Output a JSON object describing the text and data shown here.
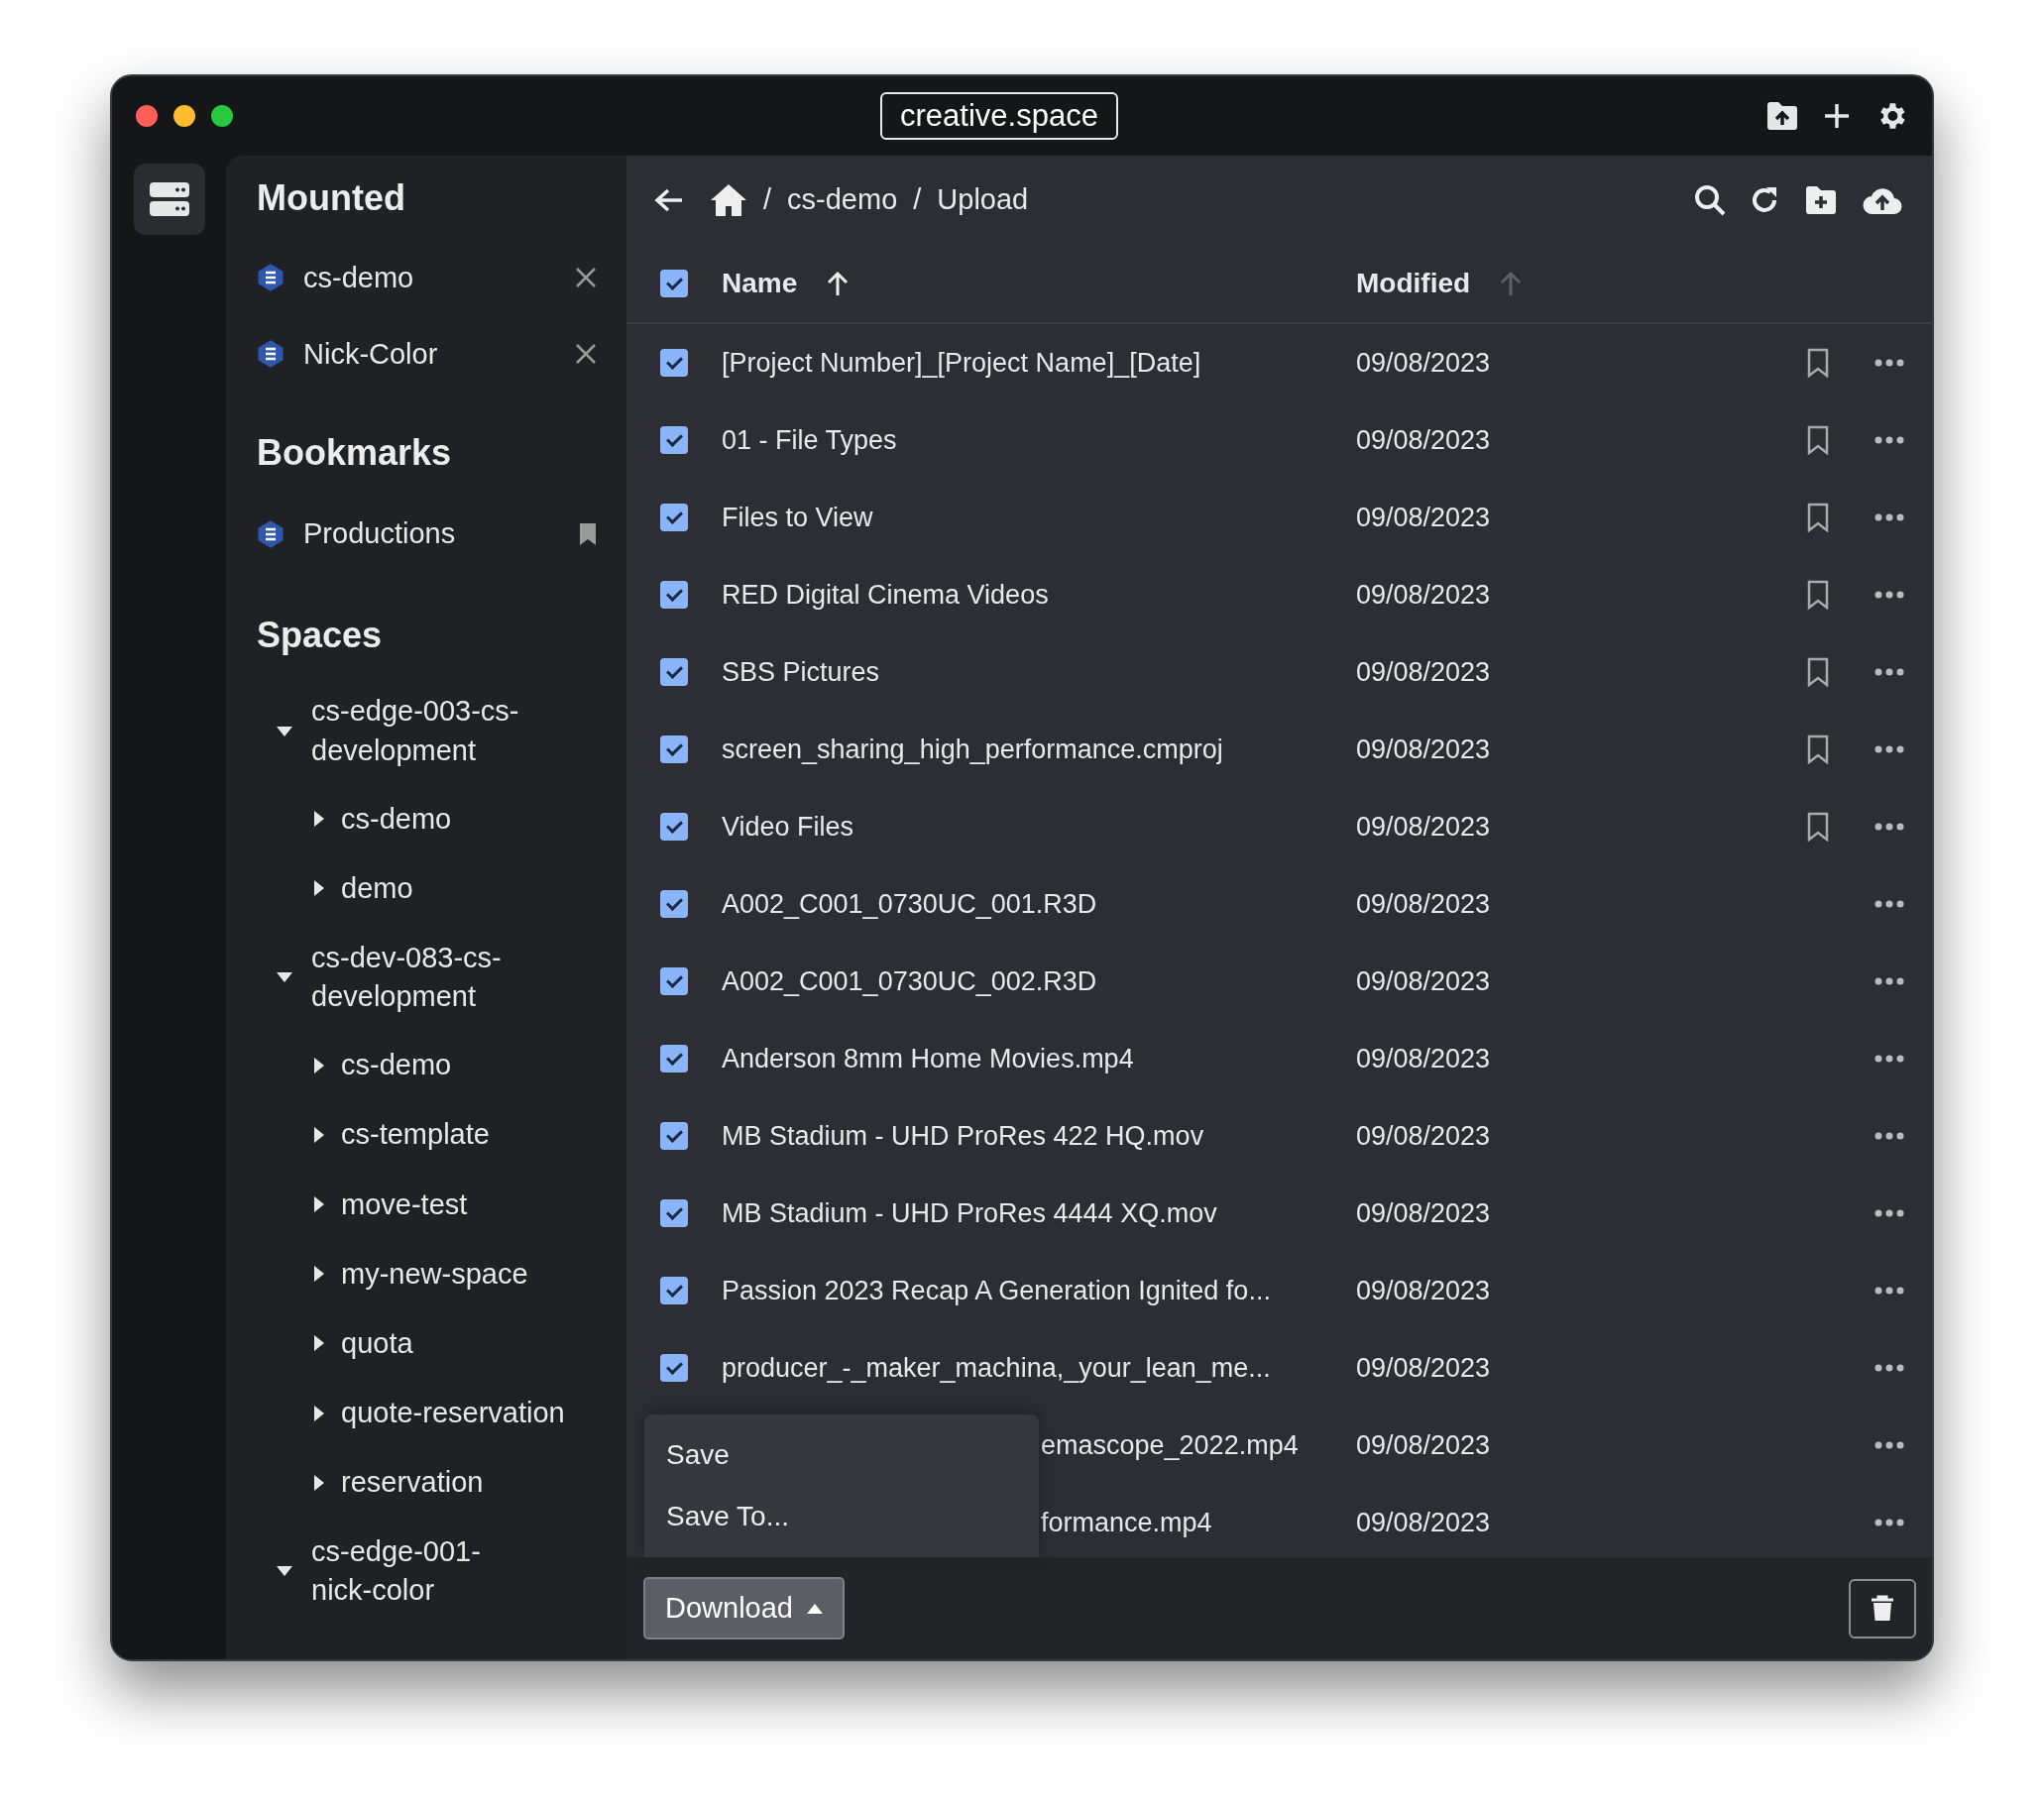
{
  "window": {
    "title": "creative.space"
  },
  "sidebar": {
    "mounted_heading": "Mounted",
    "mounted": [
      {
        "label": "cs-demo"
      },
      {
        "label": "Nick-Color"
      }
    ],
    "bookmarks_heading": "Bookmarks",
    "bookmarks": [
      {
        "label": "Productions"
      }
    ],
    "spaces_heading": "Spaces",
    "spaces": [
      {
        "label": "cs-edge-003-cs-development",
        "expanded": true,
        "children": [
          {
            "label": "cs-demo",
            "expanded": false
          },
          {
            "label": "demo",
            "expanded": false
          }
        ]
      },
      {
        "label": "cs-dev-083-cs-development",
        "expanded": true,
        "children": [
          {
            "label": "cs-demo",
            "expanded": false
          },
          {
            "label": "cs-template",
            "expanded": false
          },
          {
            "label": "move-test",
            "expanded": false
          },
          {
            "label": "my-new-space",
            "expanded": false
          },
          {
            "label": "quota",
            "expanded": false
          },
          {
            "label": "quote-reservation",
            "expanded": false
          },
          {
            "label": "reservation",
            "expanded": false
          }
        ]
      },
      {
        "label": "cs-edge-001-nick-color",
        "expanded": true
      }
    ]
  },
  "breadcrumb": [
    {
      "separator": "/",
      "label": "cs-demo"
    },
    {
      "separator": "/",
      "label": "Upload"
    }
  ],
  "table": {
    "all_checked": true,
    "columns": [
      {
        "label": "Name",
        "sorted": true
      },
      {
        "label": "Modified",
        "sorted": false
      }
    ],
    "rows": [
      {
        "kind": "file",
        "name": "[Project Number]_[Project Name]_[Date]",
        "modified": "09/08/2023",
        "checked": true,
        "bookmark": true
      },
      {
        "kind": "file",
        "name": "01 - File Types",
        "modified": "09/08/2023",
        "checked": true,
        "bookmark": true
      },
      {
        "kind": "file",
        "name": "Files to View",
        "modified": "09/08/2023",
        "checked": true,
        "bookmark": true
      },
      {
        "kind": "file",
        "name": "RED Digital Cinema Videos",
        "modified": "09/08/2023",
        "checked": true,
        "bookmark": true
      },
      {
        "kind": "file",
        "name": "SBS Pictures",
        "modified": "09/08/2023",
        "checked": true,
        "bookmark": true
      },
      {
        "kind": "file",
        "name": "screen_sharing_high_performance.cmproj",
        "modified": "09/08/2023",
        "checked": true,
        "bookmark": true
      },
      {
        "kind": "file",
        "name": "Video Files",
        "modified": "09/08/2023",
        "checked": true,
        "bookmark": true
      },
      {
        "kind": "file",
        "name": "A002_C001_0730UC_001.R3D",
        "modified": "09/08/2023",
        "checked": true,
        "bookmark": false
      },
      {
        "kind": "file",
        "name": "A002_C001_0730UC_002.R3D",
        "modified": "09/08/2023",
        "checked": true,
        "bookmark": false
      },
      {
        "kind": "file",
        "name": "Anderson 8mm Home Movies.mp4",
        "modified": "09/08/2023",
        "checked": true,
        "bookmark": false
      },
      {
        "kind": "file",
        "name": "MB Stadium - UHD ProRes 422 HQ.mov",
        "modified": "09/08/2023",
        "checked": true,
        "bookmark": false
      },
      {
        "kind": "file",
        "name": "MB Stadium - UHD ProRes 4444 XQ.mov",
        "modified": "09/08/2023",
        "checked": true,
        "bookmark": false
      },
      {
        "kind": "file",
        "name": "Passion 2023 Recap A Generation Ignited fo...",
        "modified": "09/08/2023",
        "checked": true,
        "bookmark": false
      },
      {
        "kind": "file",
        "name": "producer_-_maker_machina,_your_lean_me...",
        "modified": "09/08/2023",
        "checked": true,
        "bookmark": false
      },
      {
        "kind": "covered",
        "name": "emascope_2022.mp4",
        "modified": "09/08/2023",
        "bookmark": false
      },
      {
        "kind": "covered",
        "name": "formance.mp4",
        "modified": "09/08/2023",
        "bookmark": false
      }
    ]
  },
  "download_menu": {
    "open": true,
    "items": [
      {
        "label": "Save"
      },
      {
        "label": "Save To..."
      }
    ]
  },
  "download_button": {
    "label": "Download"
  }
}
